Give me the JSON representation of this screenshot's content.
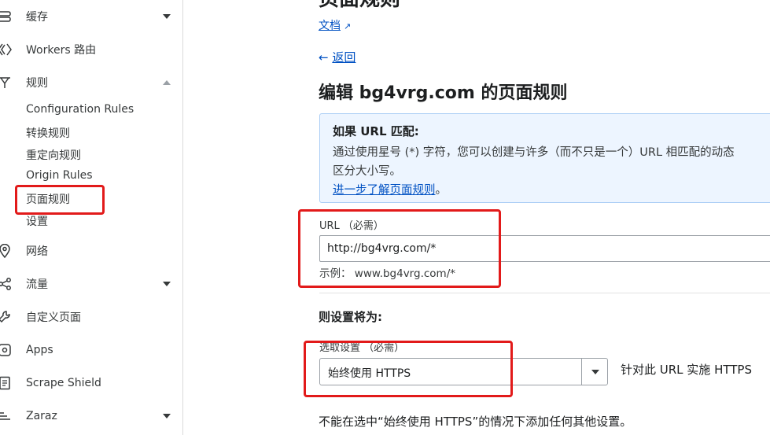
{
  "sidebar": {
    "items": [
      {
        "label": "缓存",
        "icon": "cache-icon",
        "expandable": true
      },
      {
        "label": "Workers 路由",
        "icon": "workers-icon",
        "expandable": false
      },
      {
        "label": "规则",
        "icon": "rules-icon",
        "expandable": true,
        "expanded": true
      },
      {
        "label": "网络",
        "icon": "network-icon",
        "expandable": false
      },
      {
        "label": "流量",
        "icon": "traffic-icon",
        "expandable": true
      },
      {
        "label": "自定义页面",
        "icon": "wrench-icon",
        "expandable": false
      },
      {
        "label": "Apps",
        "icon": "apps-icon",
        "expandable": false
      },
      {
        "label": "Scrape Shield",
        "icon": "document-icon",
        "expandable": false
      },
      {
        "label": "Zaraz",
        "icon": "zaraz-icon",
        "expandable": true
      }
    ],
    "rules_subitems": [
      "Configuration Rules",
      "转换规则",
      "重定向规则",
      "Origin Rules",
      "页面规则",
      "设置"
    ],
    "active_subitem": "页面规则"
  },
  "main": {
    "page_title": "页面规则",
    "doc_link": "文档",
    "back_link": "返回",
    "edit_title": "编辑 bg4vrg.com 的页面规则",
    "info": {
      "title": "如果 URL 匹配:",
      "line1": "通过使用星号 (*) 字符，您可以创建与许多（而不只是一个）URL 相匹配的动态",
      "line2": "区分大小写。",
      "link": "进一步了解页面规则",
      "link_suffix": "。"
    },
    "url_field": {
      "label": "URL （必需）",
      "value": "http://bg4vrg.com/*",
      "example": "示例： www.bg4vrg.com/*"
    },
    "settings": {
      "title": "则设置将为:",
      "select_label": "选取设置 （必需）",
      "select_value": "始终使用 HTTPS",
      "select_desc": "针对此 URL 实施 HTTPS",
      "warning": "不能在选中“始终使用 HTTPS”的情况下添加任何其他设置。"
    }
  },
  "colors": {
    "link": "#0051c3",
    "info_bg": "#edf5ff",
    "info_border": "#aacdf5",
    "highlight": "#e21a1a"
  }
}
